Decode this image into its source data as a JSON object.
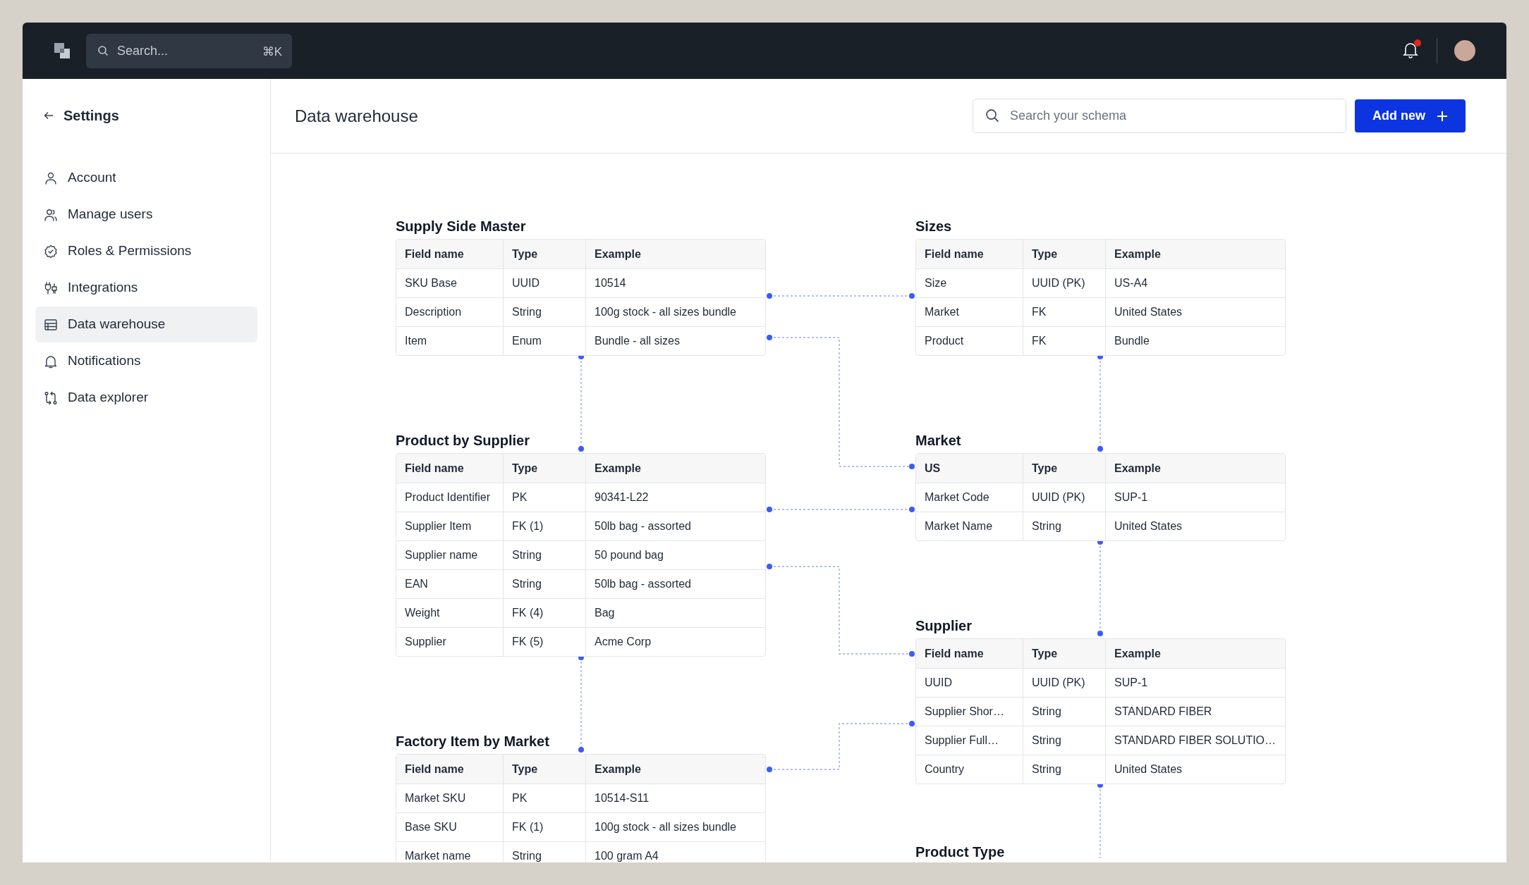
{
  "topbar": {
    "search": {
      "placeholder": "Search...",
      "shortcut": "⌘K"
    },
    "notifications": {
      "unread": true
    }
  },
  "sidebar": {
    "back": "Settings",
    "items": [
      {
        "label": "Account",
        "selected": false
      },
      {
        "label": "Manage users",
        "selected": false
      },
      {
        "label": "Roles & Permissions",
        "selected": false
      },
      {
        "label": "Integrations",
        "selected": false
      },
      {
        "label": "Data warehouse",
        "selected": true
      },
      {
        "label": "Notifications",
        "selected": false
      },
      {
        "label": "Data explorer",
        "selected": false
      }
    ]
  },
  "header": {
    "title": "Data warehouse",
    "search": {
      "placeholder": "Search your schema"
    },
    "add_button": "Add new"
  },
  "tables": [
    {
      "title": "Supply Side Master",
      "columns": [
        "Field name",
        "Type",
        "Example"
      ],
      "rows": [
        [
          "SKU Base",
          "UUID",
          "10514"
        ],
        [
          "Description",
          "String",
          "100g stock - all sizes bundle"
        ],
        [
          "Item",
          "Enum",
          "Bundle - all sizes"
        ]
      ]
    },
    {
      "title": "Sizes",
      "columns": [
        "Field name",
        "Type",
        "Example"
      ],
      "rows": [
        [
          "Size",
          "UUID (PK)",
          "US-A4"
        ],
        [
          "Market",
          "FK",
          "United States"
        ],
        [
          "Product",
          "FK",
          "Bundle"
        ]
      ]
    },
    {
      "title": "Product by Supplier",
      "columns": [
        "Field name",
        "Type",
        "Example"
      ],
      "rows": [
        [
          "Product Identifier",
          "PK",
          "90341-L22"
        ],
        [
          "Supplier Item",
          "FK (1)",
          "50lb bag - assorted"
        ],
        [
          "Supplier name",
          "String",
          "50 pound bag"
        ],
        [
          "EAN",
          "String",
          "50lb bag - assorted"
        ],
        [
          "Weight",
          "FK (4)",
          "Bag"
        ],
        [
          "Supplier",
          "FK (5)",
          "Acme Corp"
        ]
      ]
    },
    {
      "title": "Market",
      "columns": [
        "US",
        "Type",
        "Example"
      ],
      "rows": [
        [
          "Market Code",
          "UUID (PK)",
          "SUP-1"
        ],
        [
          "Market Name",
          "String",
          "United States"
        ]
      ]
    },
    {
      "title": "Supplier",
      "columns": [
        "Field name",
        "Type",
        "Example"
      ],
      "rows": [
        [
          "UUID",
          "UUID (PK)",
          "SUP-1"
        ],
        [
          "Supplier Shor…",
          "String",
          "STANDARD FIBER"
        ],
        [
          "Supplier Full…",
          "String",
          "STANDARD FIBER SOLUTIO…"
        ],
        [
          "Country",
          "String",
          "United States"
        ]
      ]
    },
    {
      "title": "Factory Item by Market",
      "columns": [
        "Field name",
        "Type",
        "Example"
      ],
      "rows": [
        [
          "Market SKU",
          "PK",
          "10514-S11"
        ],
        [
          "Base SKU",
          "FK (1)",
          "100g stock - all sizes bundle"
        ],
        [
          "Market name",
          "String",
          "100 gram A4"
        ]
      ]
    },
    {
      "title": "Product Type"
    }
  ]
}
